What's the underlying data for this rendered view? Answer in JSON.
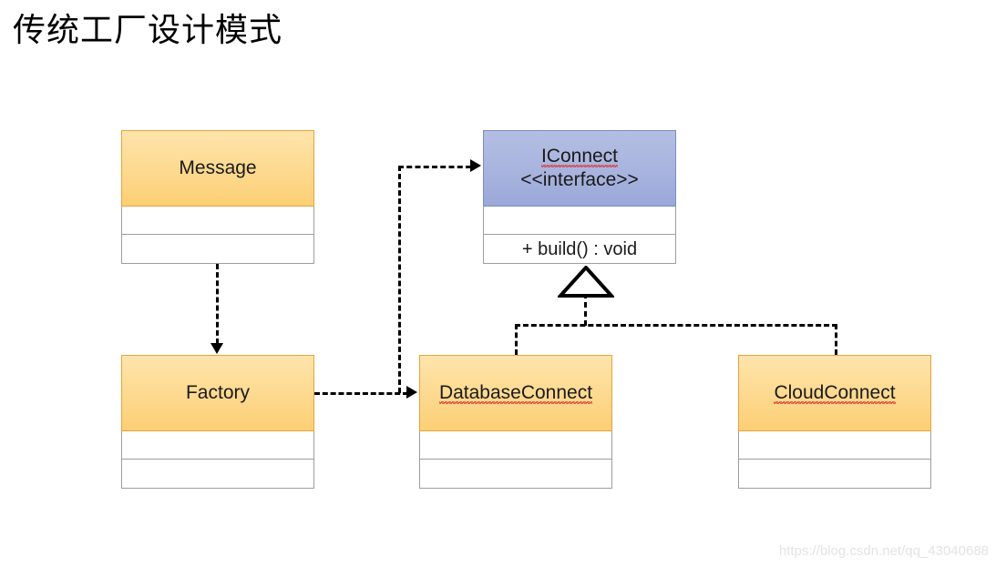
{
  "page": {
    "title": "传统工厂设计模式",
    "watermark": "https://blog.csdn.net/qq_43040688",
    "background": "#ffffff"
  },
  "colors": {
    "class_fill_top": "#fee4ab",
    "class_fill_bottom": "#fccf74",
    "class_border": "#e8a33d",
    "interface_fill_top": "#b4bee3",
    "interface_fill_bottom": "#9aa8d8",
    "interface_border": "#7b8bc4",
    "compartment_fill": "#ffffff",
    "compartment_border": "#9e9e9e",
    "connector": "#000000",
    "spellcheck_underline": "#e03535",
    "watermark": "#e4e4e4"
  },
  "diagram": {
    "type": "uml-class-diagram",
    "classes": [
      {
        "id": "message",
        "name": "Message",
        "stereotype": "",
        "misspelled": false,
        "kind": "class",
        "compartments": [
          "",
          ""
        ]
      },
      {
        "id": "iconnect",
        "name": "IConnect",
        "stereotype": "<<interface>>",
        "misspelled": true,
        "kind": "interface",
        "compartments": [
          "",
          "+ build() : void"
        ]
      },
      {
        "id": "factory",
        "name": "Factory",
        "stereotype": "",
        "misspelled": false,
        "kind": "class",
        "compartments": [
          "",
          ""
        ]
      },
      {
        "id": "databaseconnect",
        "name": "DatabaseConnect",
        "stereotype": "",
        "misspelled": true,
        "kind": "class",
        "compartments": [
          "",
          ""
        ]
      },
      {
        "id": "cloudconnect",
        "name": "CloudConnect",
        "stereotype": "",
        "misspelled": true,
        "kind": "class",
        "compartments": [
          "",
          ""
        ]
      }
    ],
    "relationships": [
      {
        "from": "message",
        "to": "factory",
        "style": "dashed",
        "arrow": "open-arrow",
        "label": ""
      },
      {
        "from": "factory",
        "to": "databaseconnect",
        "style": "dashed",
        "arrow": "open-arrow",
        "label": ""
      },
      {
        "from": "factory",
        "to": "iconnect",
        "style": "dashed",
        "arrow": "open-arrow",
        "label": ""
      },
      {
        "from": "databaseconnect",
        "to": "iconnect",
        "style": "dashed",
        "arrow": "hollow-triangle",
        "label": ""
      },
      {
        "from": "cloudconnect",
        "to": "iconnect",
        "style": "dashed",
        "arrow": "hollow-triangle",
        "label": ""
      }
    ]
  }
}
